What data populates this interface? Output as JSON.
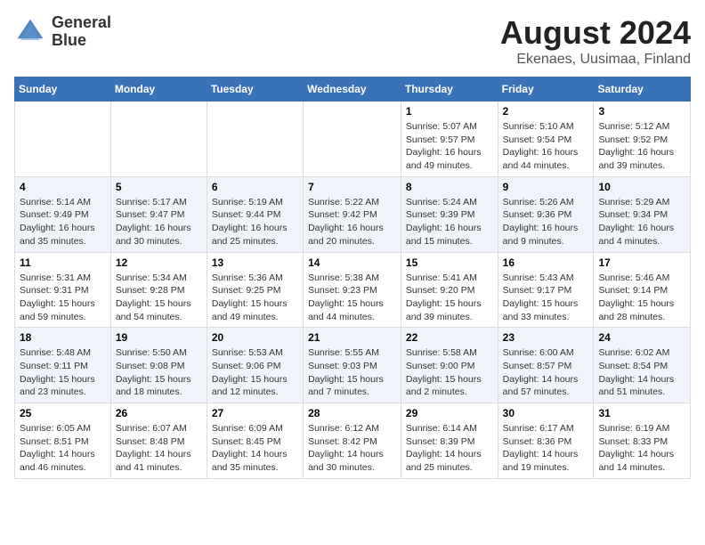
{
  "logo": {
    "text_line1": "General",
    "text_line2": "Blue"
  },
  "header": {
    "month_year": "August 2024",
    "location": "Ekenaes, Uusimaa, Finland"
  },
  "weekdays": [
    "Sunday",
    "Monday",
    "Tuesday",
    "Wednesday",
    "Thursday",
    "Friday",
    "Saturday"
  ],
  "weeks": [
    [
      {
        "day": "",
        "info": ""
      },
      {
        "day": "",
        "info": ""
      },
      {
        "day": "",
        "info": ""
      },
      {
        "day": "",
        "info": ""
      },
      {
        "day": "1",
        "info": "Sunrise: 5:07 AM\nSunset: 9:57 PM\nDaylight: 16 hours\nand 49 minutes."
      },
      {
        "day": "2",
        "info": "Sunrise: 5:10 AM\nSunset: 9:54 PM\nDaylight: 16 hours\nand 44 minutes."
      },
      {
        "day": "3",
        "info": "Sunrise: 5:12 AM\nSunset: 9:52 PM\nDaylight: 16 hours\nand 39 minutes."
      }
    ],
    [
      {
        "day": "4",
        "info": "Sunrise: 5:14 AM\nSunset: 9:49 PM\nDaylight: 16 hours\nand 35 minutes."
      },
      {
        "day": "5",
        "info": "Sunrise: 5:17 AM\nSunset: 9:47 PM\nDaylight: 16 hours\nand 30 minutes."
      },
      {
        "day": "6",
        "info": "Sunrise: 5:19 AM\nSunset: 9:44 PM\nDaylight: 16 hours\nand 25 minutes."
      },
      {
        "day": "7",
        "info": "Sunrise: 5:22 AM\nSunset: 9:42 PM\nDaylight: 16 hours\nand 20 minutes."
      },
      {
        "day": "8",
        "info": "Sunrise: 5:24 AM\nSunset: 9:39 PM\nDaylight: 16 hours\nand 15 minutes."
      },
      {
        "day": "9",
        "info": "Sunrise: 5:26 AM\nSunset: 9:36 PM\nDaylight: 16 hours\nand 9 minutes."
      },
      {
        "day": "10",
        "info": "Sunrise: 5:29 AM\nSunset: 9:34 PM\nDaylight: 16 hours\nand 4 minutes."
      }
    ],
    [
      {
        "day": "11",
        "info": "Sunrise: 5:31 AM\nSunset: 9:31 PM\nDaylight: 15 hours\nand 59 minutes."
      },
      {
        "day": "12",
        "info": "Sunrise: 5:34 AM\nSunset: 9:28 PM\nDaylight: 15 hours\nand 54 minutes."
      },
      {
        "day": "13",
        "info": "Sunrise: 5:36 AM\nSunset: 9:25 PM\nDaylight: 15 hours\nand 49 minutes."
      },
      {
        "day": "14",
        "info": "Sunrise: 5:38 AM\nSunset: 9:23 PM\nDaylight: 15 hours\nand 44 minutes."
      },
      {
        "day": "15",
        "info": "Sunrise: 5:41 AM\nSunset: 9:20 PM\nDaylight: 15 hours\nand 39 minutes."
      },
      {
        "day": "16",
        "info": "Sunrise: 5:43 AM\nSunset: 9:17 PM\nDaylight: 15 hours\nand 33 minutes."
      },
      {
        "day": "17",
        "info": "Sunrise: 5:46 AM\nSunset: 9:14 PM\nDaylight: 15 hours\nand 28 minutes."
      }
    ],
    [
      {
        "day": "18",
        "info": "Sunrise: 5:48 AM\nSunset: 9:11 PM\nDaylight: 15 hours\nand 23 minutes."
      },
      {
        "day": "19",
        "info": "Sunrise: 5:50 AM\nSunset: 9:08 PM\nDaylight: 15 hours\nand 18 minutes."
      },
      {
        "day": "20",
        "info": "Sunrise: 5:53 AM\nSunset: 9:06 PM\nDaylight: 15 hours\nand 12 minutes."
      },
      {
        "day": "21",
        "info": "Sunrise: 5:55 AM\nSunset: 9:03 PM\nDaylight: 15 hours\nand 7 minutes."
      },
      {
        "day": "22",
        "info": "Sunrise: 5:58 AM\nSunset: 9:00 PM\nDaylight: 15 hours\nand 2 minutes."
      },
      {
        "day": "23",
        "info": "Sunrise: 6:00 AM\nSunset: 8:57 PM\nDaylight: 14 hours\nand 57 minutes."
      },
      {
        "day": "24",
        "info": "Sunrise: 6:02 AM\nSunset: 8:54 PM\nDaylight: 14 hours\nand 51 minutes."
      }
    ],
    [
      {
        "day": "25",
        "info": "Sunrise: 6:05 AM\nSunset: 8:51 PM\nDaylight: 14 hours\nand 46 minutes."
      },
      {
        "day": "26",
        "info": "Sunrise: 6:07 AM\nSunset: 8:48 PM\nDaylight: 14 hours\nand 41 minutes."
      },
      {
        "day": "27",
        "info": "Sunrise: 6:09 AM\nSunset: 8:45 PM\nDaylight: 14 hours\nand 35 minutes."
      },
      {
        "day": "28",
        "info": "Sunrise: 6:12 AM\nSunset: 8:42 PM\nDaylight: 14 hours\nand 30 minutes."
      },
      {
        "day": "29",
        "info": "Sunrise: 6:14 AM\nSunset: 8:39 PM\nDaylight: 14 hours\nand 25 minutes."
      },
      {
        "day": "30",
        "info": "Sunrise: 6:17 AM\nSunset: 8:36 PM\nDaylight: 14 hours\nand 19 minutes."
      },
      {
        "day": "31",
        "info": "Sunrise: 6:19 AM\nSunset: 8:33 PM\nDaylight: 14 hours\nand 14 minutes."
      }
    ]
  ]
}
